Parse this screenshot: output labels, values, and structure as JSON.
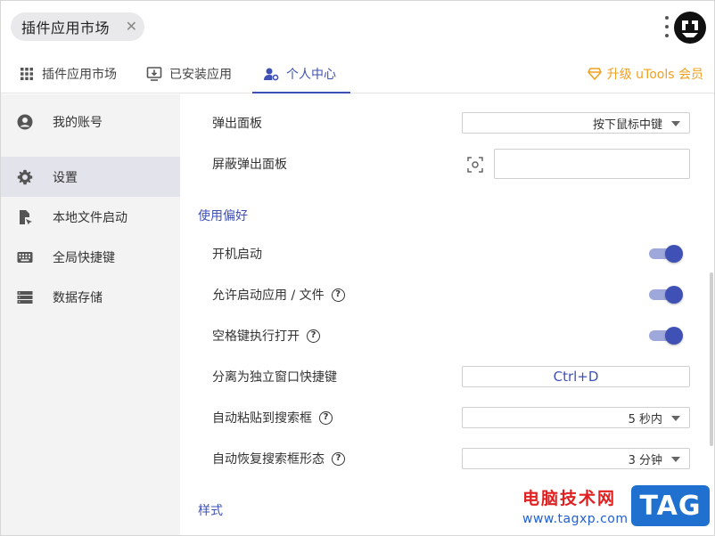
{
  "header": {
    "search_tag": "插件应用市场",
    "close_symbol": "✕"
  },
  "tabs": [
    {
      "label": "插件应用市场",
      "icon": "grid-icon"
    },
    {
      "label": "已安装应用",
      "icon": "installed-icon"
    },
    {
      "label": "个人中心",
      "icon": "user-settings-icon",
      "active": true
    }
  ],
  "upgrade": {
    "label": "升级 uTools 会员",
    "icon": "diamond-icon",
    "color": "#f0a020"
  },
  "sidebar": {
    "items": [
      {
        "label": "我的账号",
        "icon": "account-icon"
      },
      {
        "label": "设置",
        "icon": "gear-icon",
        "active": true
      },
      {
        "label": "本地文件启动",
        "icon": "file-launch-icon"
      },
      {
        "label": "全局快捷键",
        "icon": "keyboard-icon"
      },
      {
        "label": "数据存储",
        "icon": "storage-icon"
      }
    ]
  },
  "settings": {
    "popup_panel": {
      "label": "弹出面板",
      "value": "按下鼠标中键"
    },
    "block_popup": {
      "label": "屏蔽弹出面板",
      "value": ""
    },
    "preferences_title": "使用偏好",
    "auto_start": {
      "label": "开机启动",
      "on": true
    },
    "allow_launch": {
      "label": "允许启动应用 / 文件",
      "on": true
    },
    "space_open": {
      "label": "空格键执行打开",
      "on": true
    },
    "detach_hotkey": {
      "label": "分离为独立窗口快捷键",
      "value": "Ctrl+D"
    },
    "auto_paste": {
      "label": "自动粘贴到搜索框",
      "value": "5 秒内"
    },
    "auto_restore": {
      "label": "自动恢复搜索框形态",
      "value": "3 分钟"
    },
    "style_title": "样式"
  },
  "watermark": {
    "title": "电脑技术网",
    "url": "www.tagxp.com",
    "tag": "TAG"
  },
  "colors": {
    "accent": "#3f51b5",
    "toggle_track": "#9fa8da",
    "sidebar_bg": "#f3f3f3",
    "sidebar_active": "#e3e3ec"
  }
}
